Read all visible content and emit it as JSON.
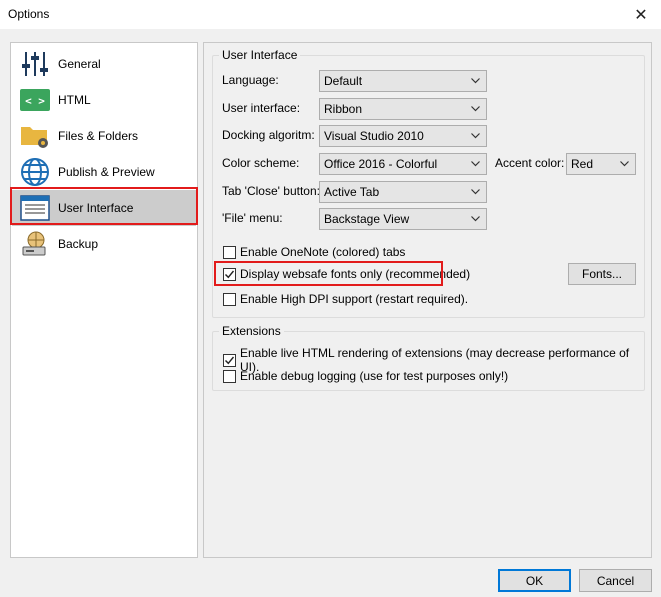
{
  "window": {
    "title": "Options",
    "close_glyph": "✕"
  },
  "nav": {
    "items": [
      {
        "label": "General",
        "icon": "sliders-icon"
      },
      {
        "label": "HTML",
        "icon": "code-icon"
      },
      {
        "label": "Files & Folders",
        "icon": "folder-gear-icon"
      },
      {
        "label": "Publish & Preview",
        "icon": "globe-icon"
      },
      {
        "label": "User Interface",
        "icon": "window-icon",
        "selected": true
      },
      {
        "label": "Backup",
        "icon": "backup-icon"
      }
    ]
  },
  "ui_group": {
    "title": "User Interface",
    "language": {
      "label": "Language:",
      "value": "Default"
    },
    "user_interface": {
      "label": "User interface:",
      "value": "Ribbon"
    },
    "docking": {
      "label": "Docking algoritm:",
      "value": "Visual Studio 2010"
    },
    "color_scheme": {
      "label": "Color scheme:",
      "value": "Office 2016 - Colorful"
    },
    "accent_color": {
      "label": "Accent color:",
      "value": "Red"
    },
    "tab_close": {
      "label": "Tab 'Close' button:",
      "value": "Active Tab"
    },
    "file_menu": {
      "label": "'File' menu:",
      "value": "Backstage View"
    },
    "enable_onenote": {
      "label": "Enable OneNote (colored) tabs",
      "checked": false
    },
    "websafe_fonts": {
      "label": "Display websafe fonts only (recommended)",
      "checked": true
    },
    "high_dpi": {
      "label": "Enable High DPI support (restart required).",
      "checked": false
    },
    "fonts_button": "Fonts..."
  },
  "extensions_group": {
    "title": "Extensions",
    "live_html": {
      "label": "Enable live HTML rendering of extensions (may decrease performance of UI).",
      "checked": true
    },
    "debug_logging": {
      "label": "Enable debug logging (use for test purposes only!)",
      "checked": false
    }
  },
  "footer": {
    "ok": "OK",
    "cancel": "Cancel"
  },
  "colors": {
    "highlight_red": "#e21b1b",
    "selected_bg": "#cccccc",
    "accent_blue": "#0078d7"
  }
}
